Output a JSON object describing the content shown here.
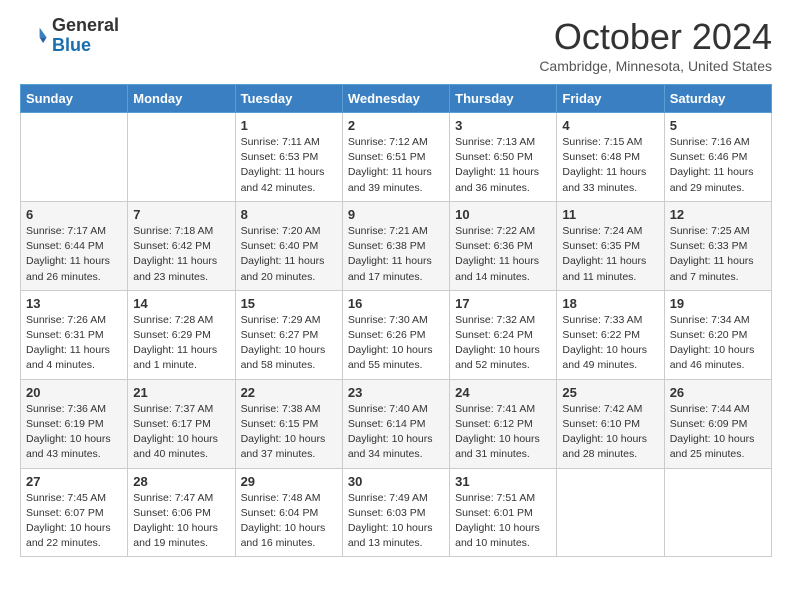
{
  "header": {
    "logo_general": "General",
    "logo_blue": "Blue",
    "month_title": "October 2024",
    "location": "Cambridge, Minnesota, United States"
  },
  "days_of_week": [
    "Sunday",
    "Monday",
    "Tuesday",
    "Wednesday",
    "Thursday",
    "Friday",
    "Saturday"
  ],
  "weeks": [
    [
      {
        "day": "",
        "sunrise": "",
        "sunset": "",
        "daylight": ""
      },
      {
        "day": "",
        "sunrise": "",
        "sunset": "",
        "daylight": ""
      },
      {
        "day": "1",
        "sunrise": "Sunrise: 7:11 AM",
        "sunset": "Sunset: 6:53 PM",
        "daylight": "Daylight: 11 hours and 42 minutes."
      },
      {
        "day": "2",
        "sunrise": "Sunrise: 7:12 AM",
        "sunset": "Sunset: 6:51 PM",
        "daylight": "Daylight: 11 hours and 39 minutes."
      },
      {
        "day": "3",
        "sunrise": "Sunrise: 7:13 AM",
        "sunset": "Sunset: 6:50 PM",
        "daylight": "Daylight: 11 hours and 36 minutes."
      },
      {
        "day": "4",
        "sunrise": "Sunrise: 7:15 AM",
        "sunset": "Sunset: 6:48 PM",
        "daylight": "Daylight: 11 hours and 33 minutes."
      },
      {
        "day": "5",
        "sunrise": "Sunrise: 7:16 AM",
        "sunset": "Sunset: 6:46 PM",
        "daylight": "Daylight: 11 hours and 29 minutes."
      }
    ],
    [
      {
        "day": "6",
        "sunrise": "Sunrise: 7:17 AM",
        "sunset": "Sunset: 6:44 PM",
        "daylight": "Daylight: 11 hours and 26 minutes."
      },
      {
        "day": "7",
        "sunrise": "Sunrise: 7:18 AM",
        "sunset": "Sunset: 6:42 PM",
        "daylight": "Daylight: 11 hours and 23 minutes."
      },
      {
        "day": "8",
        "sunrise": "Sunrise: 7:20 AM",
        "sunset": "Sunset: 6:40 PM",
        "daylight": "Daylight: 11 hours and 20 minutes."
      },
      {
        "day": "9",
        "sunrise": "Sunrise: 7:21 AM",
        "sunset": "Sunset: 6:38 PM",
        "daylight": "Daylight: 11 hours and 17 minutes."
      },
      {
        "day": "10",
        "sunrise": "Sunrise: 7:22 AM",
        "sunset": "Sunset: 6:36 PM",
        "daylight": "Daylight: 11 hours and 14 minutes."
      },
      {
        "day": "11",
        "sunrise": "Sunrise: 7:24 AM",
        "sunset": "Sunset: 6:35 PM",
        "daylight": "Daylight: 11 hours and 11 minutes."
      },
      {
        "day": "12",
        "sunrise": "Sunrise: 7:25 AM",
        "sunset": "Sunset: 6:33 PM",
        "daylight": "Daylight: 11 hours and 7 minutes."
      }
    ],
    [
      {
        "day": "13",
        "sunrise": "Sunrise: 7:26 AM",
        "sunset": "Sunset: 6:31 PM",
        "daylight": "Daylight: 11 hours and 4 minutes."
      },
      {
        "day": "14",
        "sunrise": "Sunrise: 7:28 AM",
        "sunset": "Sunset: 6:29 PM",
        "daylight": "Daylight: 11 hours and 1 minute."
      },
      {
        "day": "15",
        "sunrise": "Sunrise: 7:29 AM",
        "sunset": "Sunset: 6:27 PM",
        "daylight": "Daylight: 10 hours and 58 minutes."
      },
      {
        "day": "16",
        "sunrise": "Sunrise: 7:30 AM",
        "sunset": "Sunset: 6:26 PM",
        "daylight": "Daylight: 10 hours and 55 minutes."
      },
      {
        "day": "17",
        "sunrise": "Sunrise: 7:32 AM",
        "sunset": "Sunset: 6:24 PM",
        "daylight": "Daylight: 10 hours and 52 minutes."
      },
      {
        "day": "18",
        "sunrise": "Sunrise: 7:33 AM",
        "sunset": "Sunset: 6:22 PM",
        "daylight": "Daylight: 10 hours and 49 minutes."
      },
      {
        "day": "19",
        "sunrise": "Sunrise: 7:34 AM",
        "sunset": "Sunset: 6:20 PM",
        "daylight": "Daylight: 10 hours and 46 minutes."
      }
    ],
    [
      {
        "day": "20",
        "sunrise": "Sunrise: 7:36 AM",
        "sunset": "Sunset: 6:19 PM",
        "daylight": "Daylight: 10 hours and 43 minutes."
      },
      {
        "day": "21",
        "sunrise": "Sunrise: 7:37 AM",
        "sunset": "Sunset: 6:17 PM",
        "daylight": "Daylight: 10 hours and 40 minutes."
      },
      {
        "day": "22",
        "sunrise": "Sunrise: 7:38 AM",
        "sunset": "Sunset: 6:15 PM",
        "daylight": "Daylight: 10 hours and 37 minutes."
      },
      {
        "day": "23",
        "sunrise": "Sunrise: 7:40 AM",
        "sunset": "Sunset: 6:14 PM",
        "daylight": "Daylight: 10 hours and 34 minutes."
      },
      {
        "day": "24",
        "sunrise": "Sunrise: 7:41 AM",
        "sunset": "Sunset: 6:12 PM",
        "daylight": "Daylight: 10 hours and 31 minutes."
      },
      {
        "day": "25",
        "sunrise": "Sunrise: 7:42 AM",
        "sunset": "Sunset: 6:10 PM",
        "daylight": "Daylight: 10 hours and 28 minutes."
      },
      {
        "day": "26",
        "sunrise": "Sunrise: 7:44 AM",
        "sunset": "Sunset: 6:09 PM",
        "daylight": "Daylight: 10 hours and 25 minutes."
      }
    ],
    [
      {
        "day": "27",
        "sunrise": "Sunrise: 7:45 AM",
        "sunset": "Sunset: 6:07 PM",
        "daylight": "Daylight: 10 hours and 22 minutes."
      },
      {
        "day": "28",
        "sunrise": "Sunrise: 7:47 AM",
        "sunset": "Sunset: 6:06 PM",
        "daylight": "Daylight: 10 hours and 19 minutes."
      },
      {
        "day": "29",
        "sunrise": "Sunrise: 7:48 AM",
        "sunset": "Sunset: 6:04 PM",
        "daylight": "Daylight: 10 hours and 16 minutes."
      },
      {
        "day": "30",
        "sunrise": "Sunrise: 7:49 AM",
        "sunset": "Sunset: 6:03 PM",
        "daylight": "Daylight: 10 hours and 13 minutes."
      },
      {
        "day": "31",
        "sunrise": "Sunrise: 7:51 AM",
        "sunset": "Sunset: 6:01 PM",
        "daylight": "Daylight: 10 hours and 10 minutes."
      },
      {
        "day": "",
        "sunrise": "",
        "sunset": "",
        "daylight": ""
      },
      {
        "day": "",
        "sunrise": "",
        "sunset": "",
        "daylight": ""
      }
    ]
  ]
}
